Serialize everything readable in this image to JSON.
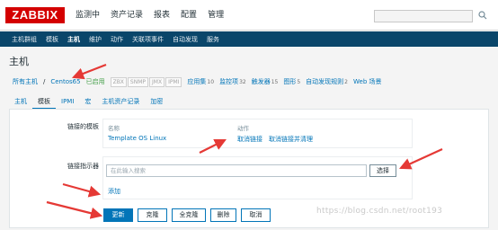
{
  "logo": "ZABBIX",
  "topnav": {
    "items": [
      "监测中",
      "资产记录",
      "报表",
      "配置",
      "管理"
    ]
  },
  "subnav": {
    "items": [
      "主机群组",
      "模板",
      "主机",
      "维护",
      "动作",
      "关联项事件",
      "自动发现",
      "服务"
    ],
    "active_index": 2
  },
  "page_title": "主机",
  "breadcrumb": {
    "all_hosts": "所有主机",
    "separator": "/",
    "host_name": "Centos65",
    "status": "已启用",
    "availability": [
      "ZBX",
      "SNMP",
      "JMX",
      "IPMI"
    ],
    "links": [
      {
        "label": "应用集",
        "count": "10"
      },
      {
        "label": "监控项",
        "count": "32"
      },
      {
        "label": "触发器",
        "count": "15"
      },
      {
        "label": "图形",
        "count": "5"
      },
      {
        "label": "自动发现规则",
        "count": "2"
      },
      {
        "label": "Web 场景",
        "count": ""
      }
    ]
  },
  "tabs": {
    "items": [
      "主机",
      "模板",
      "IPMI",
      "宏",
      "主机资产记录",
      "加密"
    ],
    "active_index": 1
  },
  "linked_templates": {
    "label": "链接的模板",
    "col_name": "名称",
    "col_action": "动作",
    "template_name": "Template OS Linux",
    "unlink": "取消链接",
    "unlink_clear": "取消链接并清理"
  },
  "link_indicator": {
    "label": "链接指示器",
    "placeholder": "在此输入搜索",
    "select": "选择",
    "add": "添加"
  },
  "buttons": {
    "update": "更新",
    "clone": "克隆",
    "full_clone": "全克隆",
    "delete": "删除",
    "cancel": "取消"
  },
  "watermark": "https://blog.csdn.net/root193",
  "colors": {
    "brand": "#d40000",
    "nav_dark": "#0a466a",
    "link": "#0275b8",
    "enabled": "#429e47",
    "annotation_arrow": "#e53935"
  }
}
